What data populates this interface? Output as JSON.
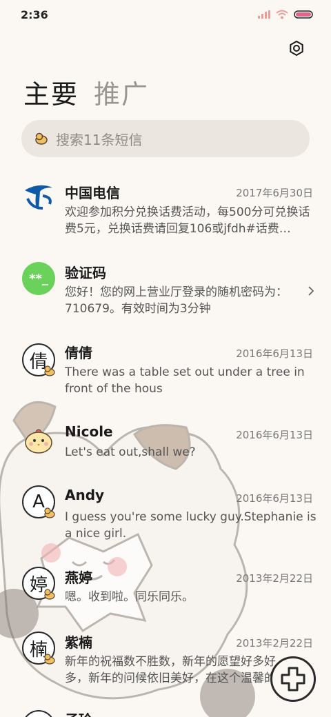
{
  "status": {
    "time": "2:36"
  },
  "tabs": [
    {
      "label": "主要"
    },
    {
      "label": "推广"
    }
  ],
  "search": {
    "placeholder": "搜索11条短信"
  },
  "conversations": [
    {
      "name": "中国电信",
      "date": "2017年6月30日",
      "preview": "欢迎参加积分兑换话费活动，每500分可兑换话费5元，兑换话费请回复106或jfdh#话费…",
      "avatar": "telecom-logo"
    },
    {
      "name": "验证码",
      "date": "",
      "preview": "您好！您的网上营业厅登录的随机密码为：710679。有效时间为3分钟",
      "avatar_text": "**_"
    },
    {
      "name": "倩倩",
      "date": "2016年6月13日",
      "preview": "There was a table set out under a tree in front of the hous",
      "avatar_text": "倩"
    },
    {
      "name": "Nicole",
      "date": "2016年6月13日",
      "preview": "Let's eat out,shall we?",
      "avatar": "chick-avatar"
    },
    {
      "name": "Andy",
      "date": "2016年6月13日",
      "preview": "I guess you're some lucky guy.Stephanie is a nice girl.",
      "avatar_text": "A"
    },
    {
      "name": "燕婷",
      "date": "2013年2月22日",
      "preview": "嗯。收到啦。同乐同乐。",
      "avatar_text": "婷"
    },
    {
      "name": "紫楠",
      "date": "2013年2月22日",
      "preview": "新年的祝福数不胜数，新年的愿望好多好多，新年的问候依旧美好，在这个温馨的时…",
      "avatar_text": "楠"
    },
    {
      "name": "子玲",
      "date": "",
      "preview": "",
      "avatar_text": ""
    }
  ],
  "colors": {
    "background": "#fbf8f3",
    "telecom_blue": "#0f5aa8",
    "verify_green": "#6ad15a",
    "search_bg": "#ebe7e0"
  }
}
